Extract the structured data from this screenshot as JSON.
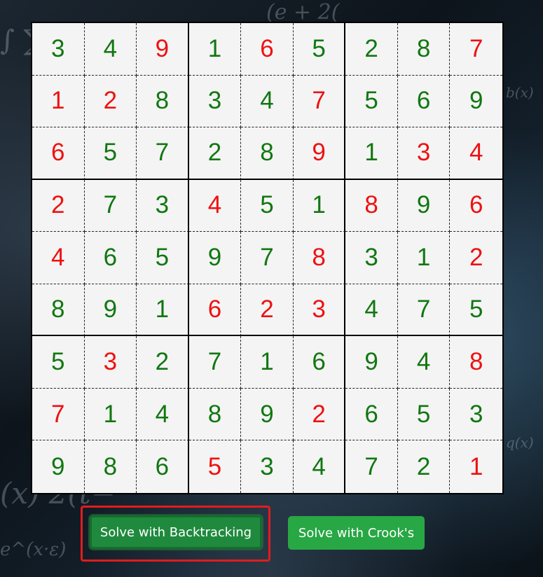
{
  "board": {
    "rows": [
      [
        {
          "v": "3",
          "s": "solved"
        },
        {
          "v": "4",
          "s": "solved"
        },
        {
          "v": "9",
          "s": "given"
        },
        {
          "v": "1",
          "s": "solved"
        },
        {
          "v": "6",
          "s": "given"
        },
        {
          "v": "5",
          "s": "solved"
        },
        {
          "v": "2",
          "s": "solved"
        },
        {
          "v": "8",
          "s": "solved"
        },
        {
          "v": "7",
          "s": "given"
        }
      ],
      [
        {
          "v": "1",
          "s": "given"
        },
        {
          "v": "2",
          "s": "given"
        },
        {
          "v": "8",
          "s": "solved"
        },
        {
          "v": "3",
          "s": "solved"
        },
        {
          "v": "4",
          "s": "solved"
        },
        {
          "v": "7",
          "s": "given"
        },
        {
          "v": "5",
          "s": "solved"
        },
        {
          "v": "6",
          "s": "solved"
        },
        {
          "v": "9",
          "s": "solved"
        }
      ],
      [
        {
          "v": "6",
          "s": "given"
        },
        {
          "v": "5",
          "s": "solved"
        },
        {
          "v": "7",
          "s": "solved"
        },
        {
          "v": "2",
          "s": "solved"
        },
        {
          "v": "8",
          "s": "solved"
        },
        {
          "v": "9",
          "s": "given"
        },
        {
          "v": "1",
          "s": "solved"
        },
        {
          "v": "3",
          "s": "given"
        },
        {
          "v": "4",
          "s": "given"
        }
      ],
      [
        {
          "v": "2",
          "s": "given"
        },
        {
          "v": "7",
          "s": "solved"
        },
        {
          "v": "3",
          "s": "solved"
        },
        {
          "v": "4",
          "s": "given"
        },
        {
          "v": "5",
          "s": "solved"
        },
        {
          "v": "1",
          "s": "solved"
        },
        {
          "v": "8",
          "s": "given"
        },
        {
          "v": "9",
          "s": "solved"
        },
        {
          "v": "6",
          "s": "given"
        }
      ],
      [
        {
          "v": "4",
          "s": "given"
        },
        {
          "v": "6",
          "s": "solved"
        },
        {
          "v": "5",
          "s": "solved"
        },
        {
          "v": "9",
          "s": "solved"
        },
        {
          "v": "7",
          "s": "solved"
        },
        {
          "v": "8",
          "s": "given"
        },
        {
          "v": "3",
          "s": "solved"
        },
        {
          "v": "1",
          "s": "solved"
        },
        {
          "v": "2",
          "s": "given"
        }
      ],
      [
        {
          "v": "8",
          "s": "solved"
        },
        {
          "v": "9",
          "s": "solved"
        },
        {
          "v": "1",
          "s": "solved"
        },
        {
          "v": "6",
          "s": "given"
        },
        {
          "v": "2",
          "s": "given"
        },
        {
          "v": "3",
          "s": "given"
        },
        {
          "v": "4",
          "s": "solved"
        },
        {
          "v": "7",
          "s": "solved"
        },
        {
          "v": "5",
          "s": "solved"
        }
      ],
      [
        {
          "v": "5",
          "s": "solved"
        },
        {
          "v": "3",
          "s": "given"
        },
        {
          "v": "2",
          "s": "solved"
        },
        {
          "v": "7",
          "s": "solved"
        },
        {
          "v": "1",
          "s": "solved"
        },
        {
          "v": "6",
          "s": "solved"
        },
        {
          "v": "9",
          "s": "solved"
        },
        {
          "v": "4",
          "s": "solved"
        },
        {
          "v": "8",
          "s": "given"
        }
      ],
      [
        {
          "v": "7",
          "s": "given"
        },
        {
          "v": "1",
          "s": "solved"
        },
        {
          "v": "4",
          "s": "solved"
        },
        {
          "v": "8",
          "s": "solved"
        },
        {
          "v": "9",
          "s": "solved"
        },
        {
          "v": "2",
          "s": "given"
        },
        {
          "v": "6",
          "s": "solved"
        },
        {
          "v": "5",
          "s": "solved"
        },
        {
          "v": "3",
          "s": "solved"
        }
      ],
      [
        {
          "v": "9",
          "s": "solved"
        },
        {
          "v": "8",
          "s": "solved"
        },
        {
          "v": "6",
          "s": "solved"
        },
        {
          "v": "5",
          "s": "given"
        },
        {
          "v": "3",
          "s": "solved"
        },
        {
          "v": "4",
          "s": "solved"
        },
        {
          "v": "7",
          "s": "solved"
        },
        {
          "v": "2",
          "s": "solved"
        },
        {
          "v": "1",
          "s": "given"
        }
      ]
    ]
  },
  "buttons": {
    "backtracking_label": "Solve with Backtracking",
    "crook_label": "Solve with Crook's"
  },
  "colors": {
    "given_digit": "#ee1111",
    "solved_digit": "#117711",
    "button_green": "#28a745",
    "highlight_red": "#e21c1c"
  }
}
